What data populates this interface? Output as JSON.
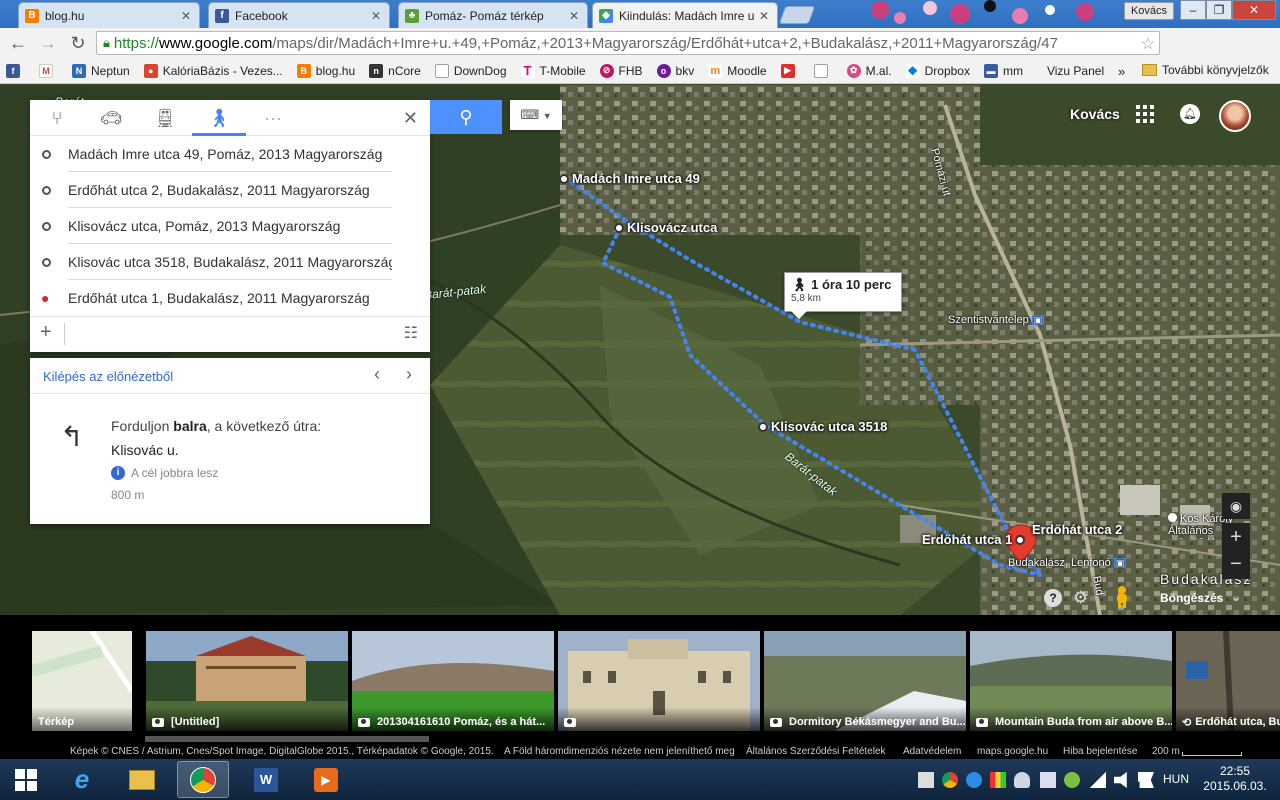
{
  "tabs": [
    {
      "label": "blog.hu",
      "icon": "blogger-icon",
      "color": "#f57d00"
    },
    {
      "label": "Facebook",
      "icon": "facebook-icon",
      "color": "#3b5998"
    },
    {
      "label": "Pomáz- Pomáz térkép",
      "icon": "tree-icon",
      "color": "#5a9f3a"
    },
    {
      "label": "Kiindulás: Madách Imre u",
      "icon": "maps-icon",
      "color": "#34a853"
    }
  ],
  "profile": "Kovács",
  "address": {
    "scheme": "https://",
    "host": "www.google.com",
    "path": "/maps/dir/Madách+Imre+u.+49,+Pomáz,+2013+Magyarország/Erdőhát+utca+2,+Budakalász,+2011+Magyarország/47"
  },
  "bookmarks": [
    {
      "label": "",
      "icon": "facebook-icon",
      "color": "#3b5998"
    },
    {
      "label": "",
      "icon": "gmail-icon",
      "color": "#d14836"
    },
    {
      "label": "Neptun",
      "icon": "neptun-icon",
      "color": "#2d6db5"
    },
    {
      "label": "KalóriaBázis - Vezes...",
      "icon": "apple-icon",
      "color": "#d9442b"
    },
    {
      "label": "blog.hu",
      "icon": "blogger-icon",
      "color": "#f57d00"
    },
    {
      "label": "nCore",
      "icon": "ncore-icon",
      "color": "#333333"
    },
    {
      "label": "DownDog",
      "icon": "page-icon",
      "color": "#9aa3ad"
    },
    {
      "label": "T-Mobile",
      "icon": "tmobile-icon",
      "color": "#e20074"
    },
    {
      "label": "FHB",
      "icon": "fhb-icon",
      "color": "#c2185b"
    },
    {
      "label": "bkv",
      "icon": "bkv-icon",
      "color": "#6a1b9a"
    },
    {
      "label": "Moodle",
      "icon": "moodle-icon",
      "color": "#f98012"
    },
    {
      "label": "",
      "icon": "youtube-icon",
      "color": "#e52d27"
    },
    {
      "label": "",
      "icon": "page-icon",
      "color": "#9aa3ad"
    },
    {
      "label": "M.al.",
      "icon": "flower-icon",
      "color": "#d64a8a"
    },
    {
      "label": "Dropbox",
      "icon": "dropbox-icon",
      "color": "#007ee5"
    },
    {
      "label": "mm",
      "icon": "mm-icon",
      "color": "#3a5ba0"
    },
    {
      "label": "Vizu Panel",
      "icon": "",
      "color": ""
    }
  ],
  "bookmarks_more": "»",
  "bookmarks_folder": "További könyvjelzők",
  "map_top": {
    "account_name": "Kovács"
  },
  "directions": {
    "waypoints": [
      "Madách Imre utca 49, Pomáz, 2013 Magyarország",
      "Erdőhát utca 2, Budakalász, 2011 Magyarország",
      "Klisovácz utca, Pomáz, 2013 Magyarország",
      "Klisovác utca 3518, Budakalász, 2011 Magyarország",
      "Erdőhát utca 1, Budakalász, 2011 Magyarország"
    ],
    "exit_preview": "Kilépés az előnézetből",
    "step": {
      "instruction_pre": "Forduljon ",
      "instruction_bold": "balra",
      "instruction_post": ", a következő útra:",
      "road": "Klisovác u.",
      "note": "A cél jobbra lesz",
      "distance": "800 m"
    }
  },
  "route": {
    "time": "1 óra 10 perc",
    "distance": "5,8 km",
    "color": "#4285f4"
  },
  "map_labels": {
    "pins": [
      "Madách Imre utca 49",
      "Klisovácz utca",
      "Klisovác utca 3518",
      "Erdőhát utca 1",
      "Erdőhát utca 2"
    ],
    "places": {
      "road1": "Pomázi út",
      "stop1": "Szentistvántelep",
      "stop2": "Budakalász, Lenfonó",
      "culture": "Kós Károly Általános Művelődési Központ",
      "town": "Budakalász",
      "bud": "Bud"
    },
    "streams": [
      "Barát-patak",
      "Barát-patak",
      "Barát"
    ]
  },
  "browse_label": "Böngészés",
  "photos": [
    {
      "caption": "Térkép",
      "kind": "map"
    },
    {
      "caption": "[Untitled]",
      "kind": "photo"
    },
    {
      "caption": "201304161610 Pomáz, és a hát...",
      "kind": "photo"
    },
    {
      "caption": "",
      "kind": "photo"
    },
    {
      "caption": "Dormitory Békásmegyer and Bu...",
      "kind": "photo"
    },
    {
      "caption": "Mountain Buda from air above B...",
      "kind": "photo"
    },
    {
      "caption": "Erdőhát utca, Bu",
      "kind": "streetview"
    }
  ],
  "footer": {
    "credits": "Képek © CNES / Astrium, Cnes/Spot Image, DigitalGlobe 2015., Térképadatok © Google, 2015.",
    "three_d": "A Föld háromdimenziós nézete nem jeleníthető meg",
    "terms": "Általános Szerződési Feltételek",
    "privacy": "Adatvédelem",
    "domain": "maps.google.hu",
    "report": "Hiba bejelentése",
    "scale": "200 m"
  },
  "taskbar": {
    "lang": "HUN",
    "time": "22:55",
    "date": "2015.06.03."
  }
}
